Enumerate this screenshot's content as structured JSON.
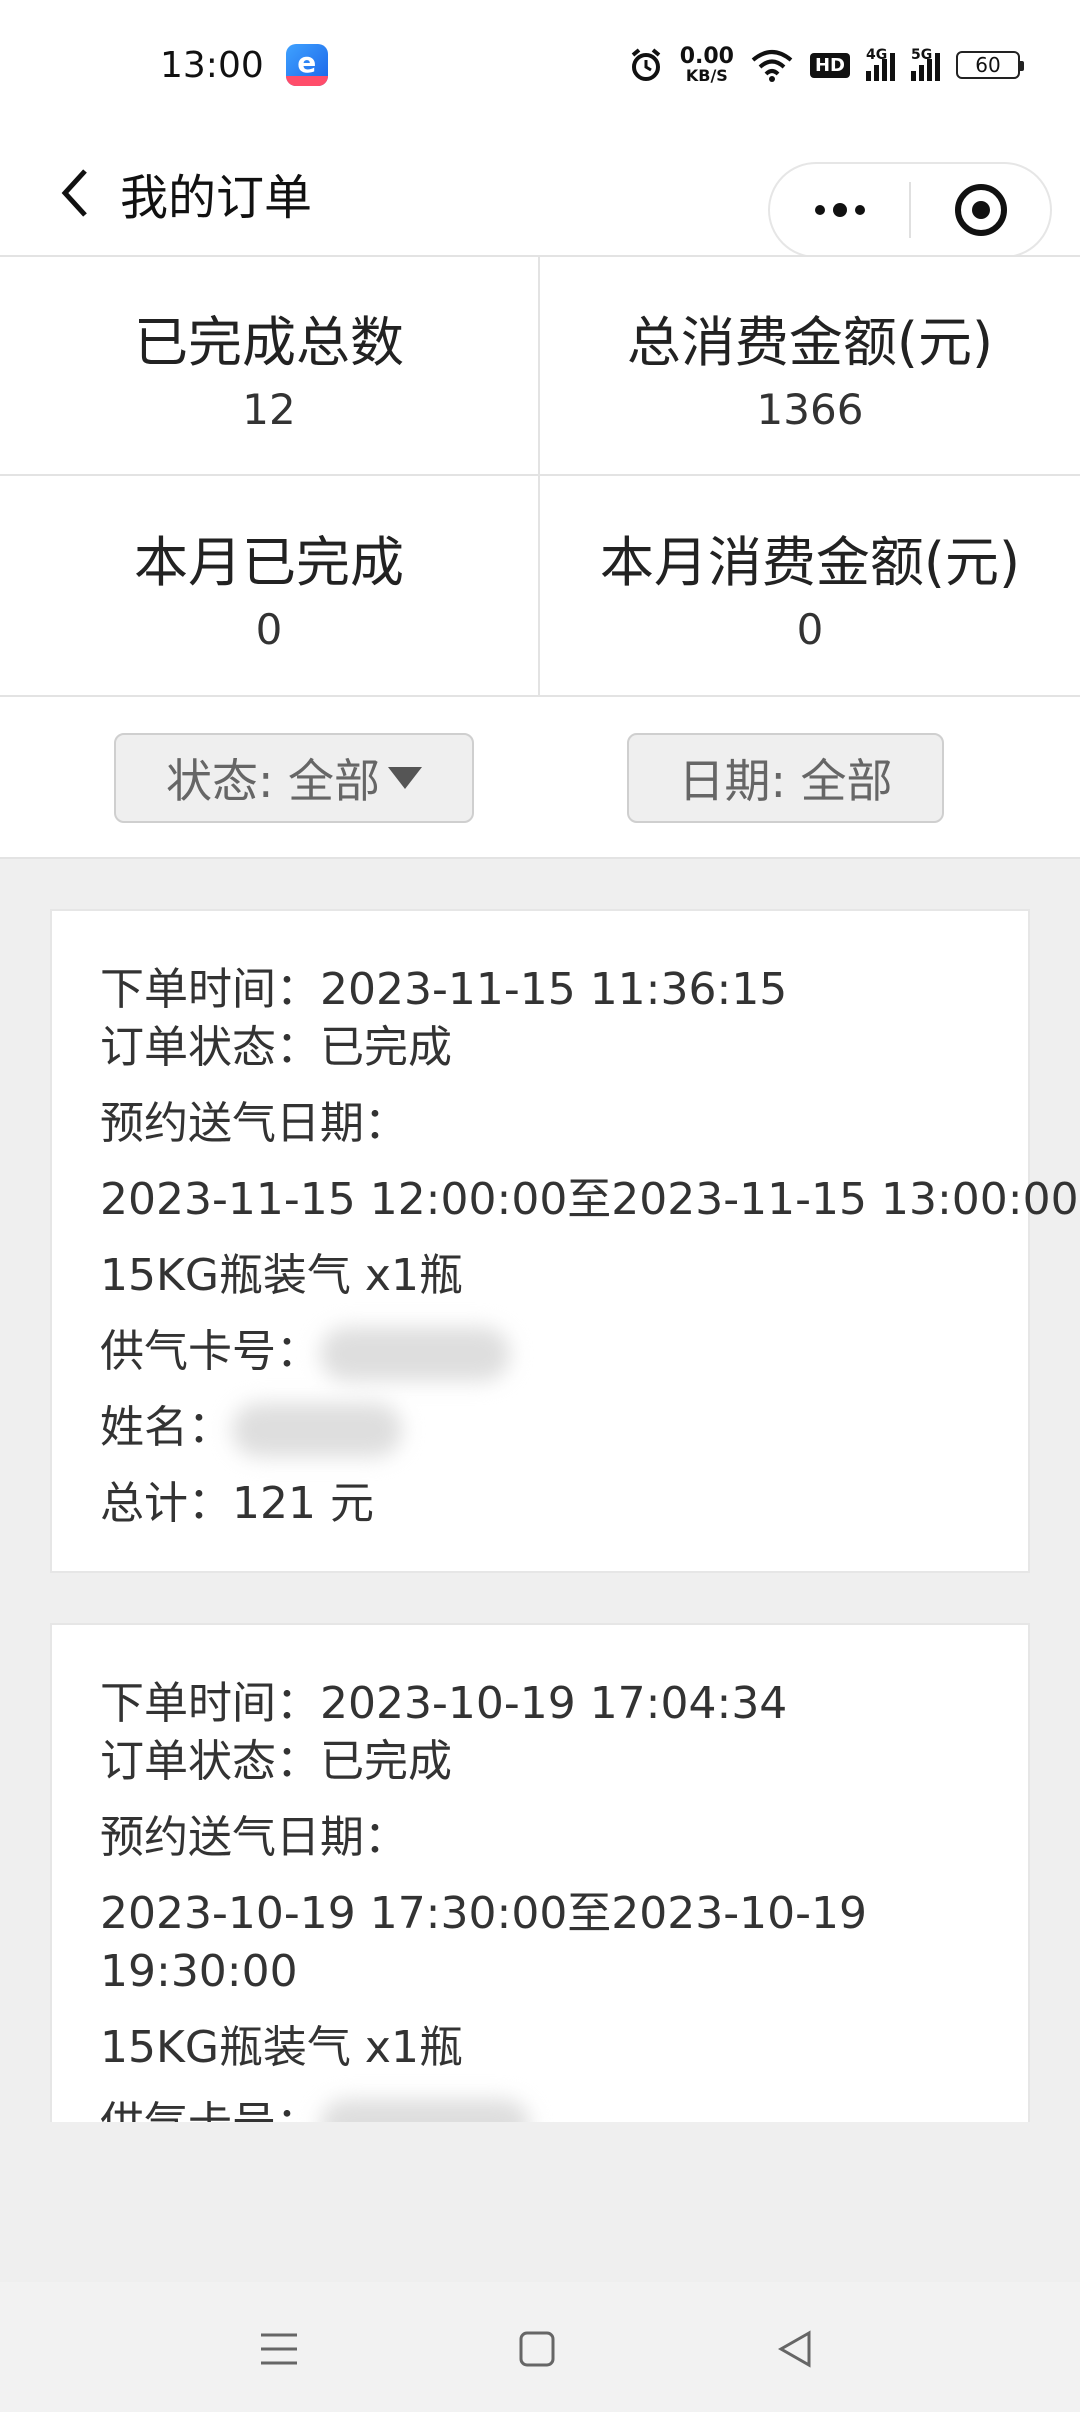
{
  "status_bar": {
    "time": "13:00",
    "net_speed_value": "0.00",
    "net_speed_unit": "KB/S",
    "hd_label": "HD",
    "signal1_label": "4G",
    "signal2_label": "5G",
    "battery": "60",
    "icons": [
      "app-icon",
      "alarm-icon",
      "wifi-icon",
      "signal-icon",
      "battery-icon"
    ]
  },
  "nav": {
    "title": "我的订单",
    "icons": [
      "back-icon",
      "more-icon",
      "target-icon"
    ]
  },
  "stats": [
    {
      "label": "已完成总数",
      "value": "12"
    },
    {
      "label": "总消费金额(元)",
      "value": "1366"
    },
    {
      "label": "本月已完成",
      "value": "0"
    },
    {
      "label": "本月消费金额(元)",
      "value": "0"
    }
  ],
  "filters": {
    "status_label": "状态: 全部",
    "date_label": "日期: 全部"
  },
  "orders": [
    {
      "order_time": "下单时间：2023-11-15 11:36:15",
      "status": "订单状态：已完成",
      "delivery_label": "预约送气日期：",
      "delivery_range": "2023-11-15 12:00:00至2023-11-15 13:00:00",
      "product": "15KG瓶装气 x1瓶",
      "card_label": "供气卡号：",
      "name_label": "姓名：",
      "total": "总计：121 元"
    },
    {
      "order_time": "下单时间：2023-10-19 17:04:34",
      "status": "订单状态：已完成",
      "delivery_label": "预约送气日期：",
      "delivery_range_line1": "2023-10-19 17:30:00至2023-10-19",
      "delivery_range_line2": "19:30:00",
      "product": "15KG瓶装气 x1瓶",
      "card_label": "供气卡号："
    }
  ],
  "bottom_nav": {
    "icons": [
      "menu-icon",
      "home-icon",
      "back-triangle-icon"
    ]
  }
}
